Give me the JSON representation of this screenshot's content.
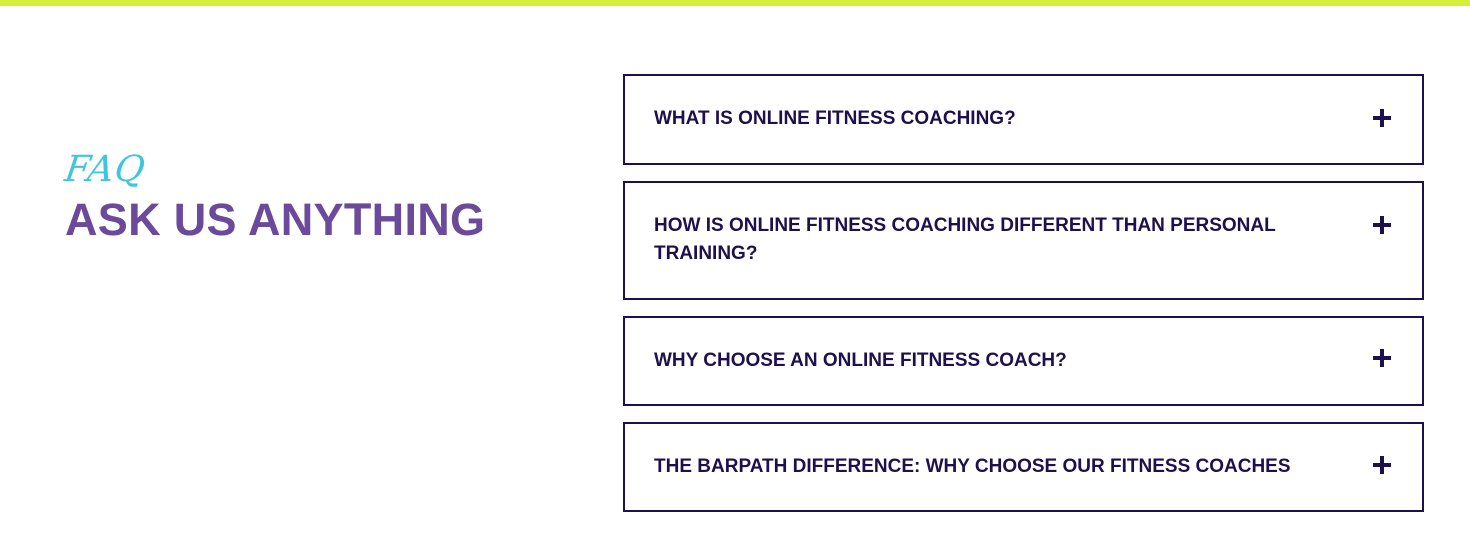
{
  "section": {
    "eyebrow": "FAQ",
    "title": "ASK US ANYTHING"
  },
  "faq": {
    "items": [
      {
        "question": "WHAT IS ONLINE FITNESS COACHING?",
        "icon": "plus-icon",
        "expanded": false
      },
      {
        "question": "HOW IS ONLINE FITNESS COACHING DIFFERENT THAN PERSONAL TRAINING?",
        "icon": "plus-icon",
        "expanded": false
      },
      {
        "question": "WHY CHOOSE AN ONLINE FITNESS COACH?",
        "icon": "plus-icon",
        "expanded": false
      },
      {
        "question": "THE BARPATH DIFFERENCE: WHY CHOOSE OUR FITNESS COACHES",
        "icon": "plus-icon",
        "expanded": false
      }
    ]
  },
  "colors": {
    "accent_bar": "#d4f03c",
    "eyebrow": "#3fc6de",
    "heading": "#6b4a9b",
    "faq_text": "#1e0f4d",
    "faq_border": "#1e0f4d"
  }
}
